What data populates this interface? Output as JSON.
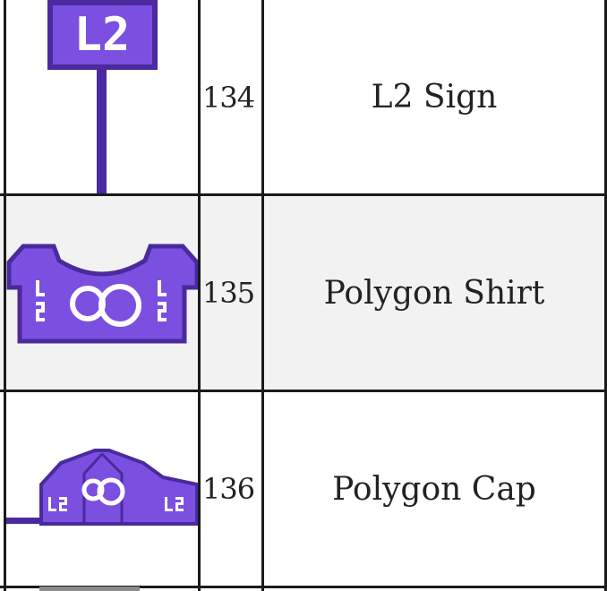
{
  "colors": {
    "purple": "#7b4fe0",
    "purple_dark": "#4a2a9e",
    "border": "#1a1a1a",
    "row_alt": "#f2f2f2"
  },
  "rows": [
    {
      "id": "134",
      "name": "L2 Sign",
      "icon": "l2-sign-icon",
      "sign_text": "L2"
    },
    {
      "id": "135",
      "name": "Polygon Shirt",
      "icon": "polygon-shirt-icon"
    },
    {
      "id": "136",
      "name": "Polygon Cap",
      "icon": "polygon-cap-icon"
    }
  ]
}
